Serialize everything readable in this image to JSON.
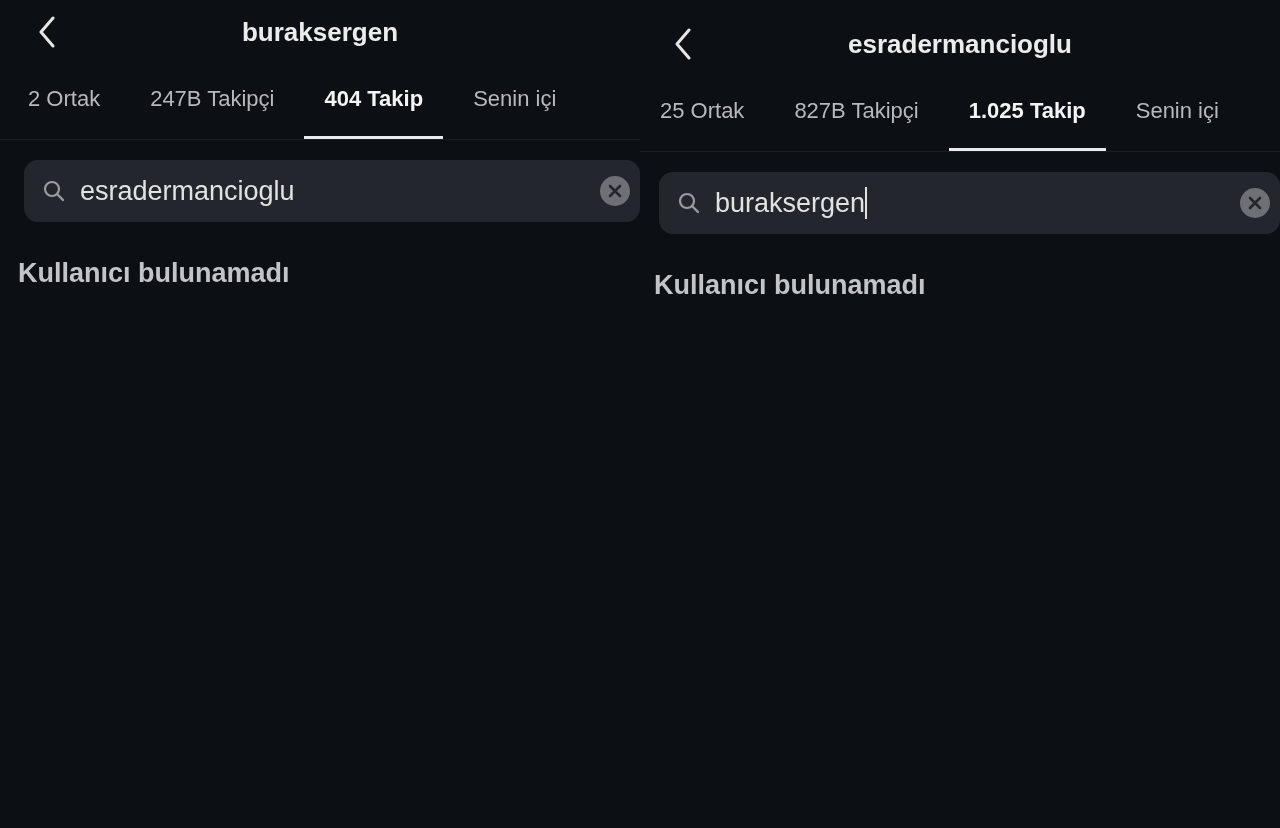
{
  "panels": [
    {
      "title": "buraksergen",
      "tabs": [
        {
          "label": "2 Ortak",
          "selected": false
        },
        {
          "label": "247B Takipçi",
          "selected": false
        },
        {
          "label": "404 Takip",
          "selected": true
        },
        {
          "label": "Senin içi",
          "selected": false
        }
      ],
      "search": {
        "value": "esradermancioglu",
        "focused": false
      },
      "message": "Kullanıcı bulunamadı"
    },
    {
      "title": "esradermancioglu",
      "tabs": [
        {
          "label": "25 Ortak",
          "selected": false
        },
        {
          "label": "827B Takipçi",
          "selected": false
        },
        {
          "label": "1.025 Takip",
          "selected": true
        },
        {
          "label": "Senin içi",
          "selected": false
        }
      ],
      "search": {
        "value": "buraksergen",
        "focused": true
      },
      "message": "Kullanıcı bulunamadı"
    }
  ]
}
